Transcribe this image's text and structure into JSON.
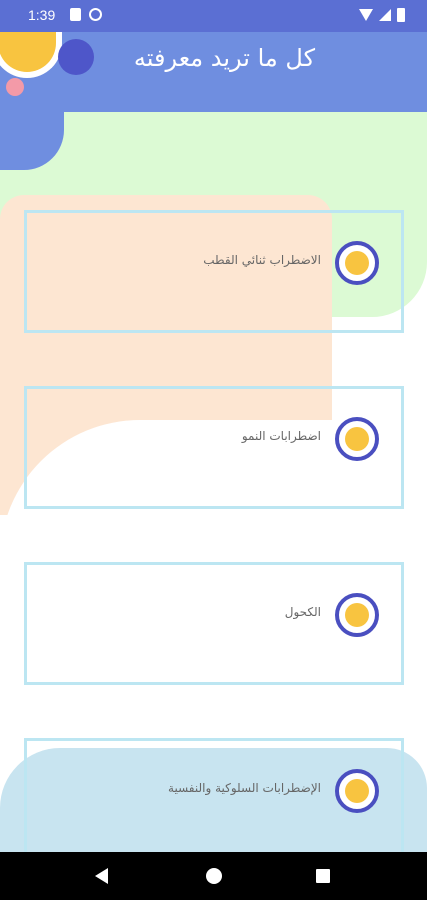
{
  "status_bar": {
    "time": "1:39",
    "icons": [
      "notification-icon",
      "no-tracking-icon",
      "wifi-icon",
      "signal-icon",
      "battery-icon"
    ]
  },
  "header": {
    "title": "كل ما تريد معرفته"
  },
  "items": [
    {
      "label": "الاضطراب ثنائي القطب",
      "selected": false
    },
    {
      "label": "اضطرابات النمو",
      "selected": false
    },
    {
      "label": "الكحول",
      "selected": false
    },
    {
      "label": "الإضطرابات السلوكية والنفسية",
      "selected": false
    }
  ],
  "colors": {
    "status_bar": "#5b6fd3",
    "header": "#6f8ee0",
    "accent_yellow": "#f8c440",
    "radio_ring": "#4a4fc0",
    "card_border": "#bce6f2"
  },
  "nav_bar": {
    "icons": [
      "back-icon",
      "home-icon",
      "recents-icon"
    ]
  }
}
